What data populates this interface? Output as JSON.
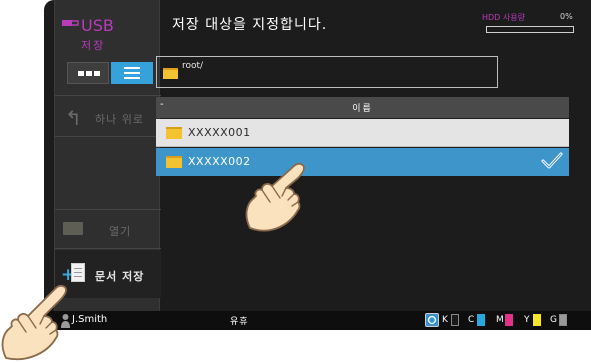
{
  "sidebar": {
    "usb_label": "USB",
    "usb_sub": "저장",
    "up_label": "하나 위로",
    "open_label": "열기",
    "save_label": "문서 저장"
  },
  "header": {
    "title": "저장 대상을 지정합니다.",
    "hdd_label": "HDD 사용량",
    "hdd_percent": "0%",
    "hdd_usage_fraction": 0
  },
  "path": {
    "value": "root/"
  },
  "list": {
    "sort_indicator": "-",
    "column_name": "이름",
    "rows": [
      {
        "label": "XXXXX001",
        "selected": false
      },
      {
        "label": "XXXXX002",
        "selected": true
      }
    ]
  },
  "status": {
    "user": "J.Smith",
    "state": "유휴",
    "toners": [
      {
        "letter": "K",
        "color": "#1a1a1a"
      },
      {
        "letter": "C",
        "color": "#2aa7e0"
      },
      {
        "letter": "M",
        "color": "#e0338a"
      },
      {
        "letter": "Y",
        "color": "#f5e62a"
      },
      {
        "letter": "G",
        "color": "#9a9a9a"
      }
    ]
  },
  "colors": {
    "accent_purple": "#b63cb8",
    "accent_blue": "#35a2dc",
    "selected_row": "#3d95c9"
  }
}
